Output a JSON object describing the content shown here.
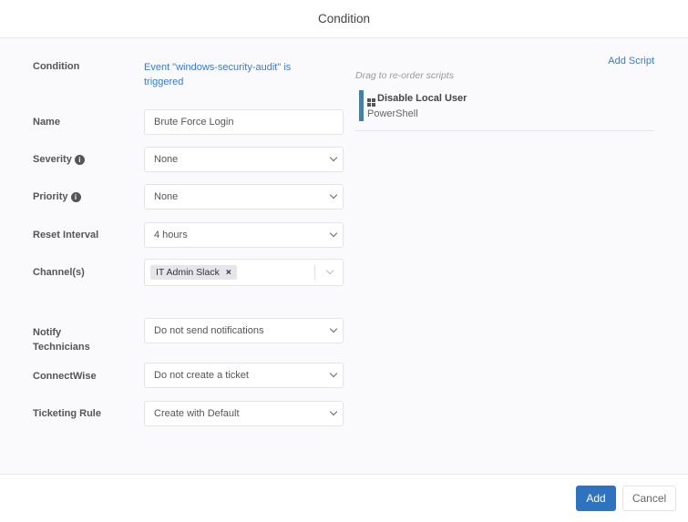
{
  "dialog": {
    "title": "Condition"
  },
  "form": {
    "condition_label": "Condition",
    "condition_value": "Event \"windows-security-audit\" is triggered",
    "name_label": "Name",
    "name_value": "Brute Force Login",
    "severity_label": "Severity",
    "severity_value": "None",
    "priority_label": "Priority",
    "priority_value": "None",
    "reset_label": "Reset Interval",
    "reset_value": "4 hours",
    "channels_label": "Channel(s)",
    "channel_tag": "IT Admin Slack",
    "notify_label": "Notify Technicians",
    "notify_value": "Do not send notifications",
    "connectwise_label": "ConnectWise",
    "connectwise_value": "Do not create a ticket",
    "ticketing_label": "Ticketing Rule",
    "ticketing_value": "Create with Default"
  },
  "scripts": {
    "add_label": "Add Script",
    "hint": "Drag to re-order scripts",
    "items": [
      {
        "name": "Disable Local User",
        "type": "PowerShell"
      }
    ]
  },
  "footer": {
    "add_label": "Add",
    "cancel_label": "Cancel"
  },
  "colors": {
    "primary": "#2f72c0",
    "link": "#3a7bc8",
    "script_bar": "#4a7fa0"
  }
}
